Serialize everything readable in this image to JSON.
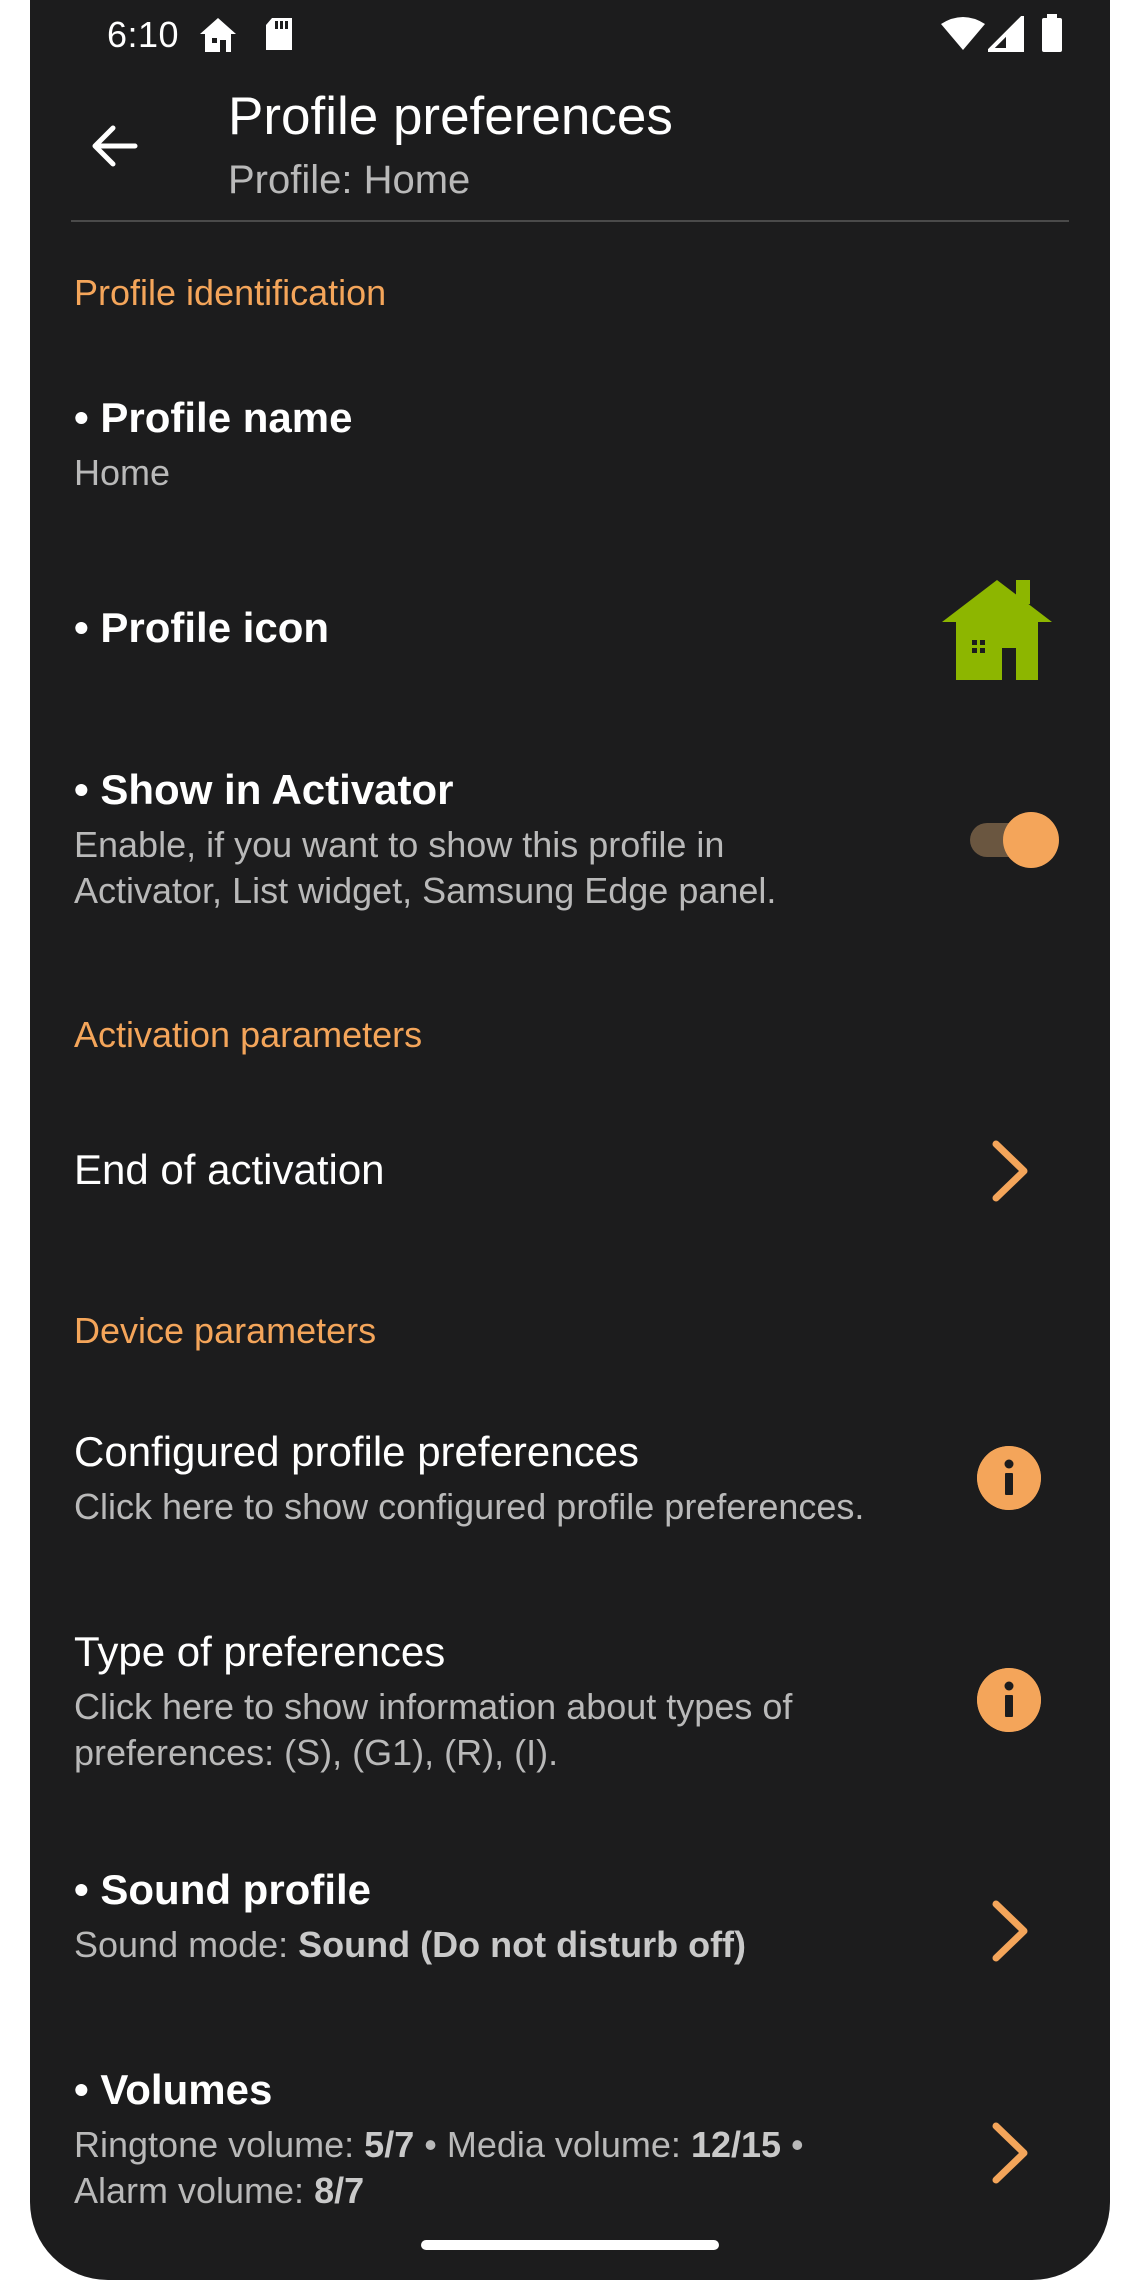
{
  "status_bar": {
    "time": "6:10",
    "left_icons": [
      "home-notification-icon",
      "sd-card-icon"
    ],
    "right_icons": [
      "wifi-icon",
      "cell-signal-icon",
      "battery-icon"
    ]
  },
  "toolbar": {
    "back_icon": "arrow-back-icon",
    "title": "Profile preferences",
    "subtitle": "Profile: Home"
  },
  "sections": {
    "identification": {
      "header": "Profile identification"
    },
    "activation": {
      "header": "Activation parameters"
    },
    "device": {
      "header": "Device parameters"
    }
  },
  "prefs": {
    "profile_name": {
      "title": "• Profile name",
      "summary": "Home"
    },
    "profile_icon": {
      "title": "• Profile icon",
      "icon": "house-icon",
      "icon_color": "#8db600"
    },
    "show_in_activator": {
      "title": "• Show in Activator",
      "summary": "Enable, if you want to show this profile in Activator, List widget, Samsung Edge panel.",
      "enabled": true
    },
    "end_of_activation": {
      "title": "End of activation"
    },
    "configured_prefs": {
      "title": "Configured profile preferences",
      "summary": "Click here to show configured profile preferences."
    },
    "type_of_prefs": {
      "title": "Type of preferences",
      "summary": "Click here to show information about types of preferences: (S), (G1), (R), (I)."
    },
    "sound_profile": {
      "title": "• Sound profile",
      "summary_label": "Sound mode: ",
      "summary_value": "Sound (Do not disturb off)"
    },
    "volumes": {
      "title": "• Volumes",
      "ringtone_label": "Ringtone volume: ",
      "ringtone_value": "5/7",
      "sep1": " • ",
      "media_label": "Media volume: ",
      "media_value": "12/15",
      "sep2": " •",
      "alarm_label": "Alarm volume: ",
      "alarm_value": "8/7"
    }
  },
  "colors": {
    "accent": "#f4a55a",
    "background": "#1c1c1d",
    "text_primary": "#ffffff",
    "text_secondary": "#b9b9b9"
  }
}
